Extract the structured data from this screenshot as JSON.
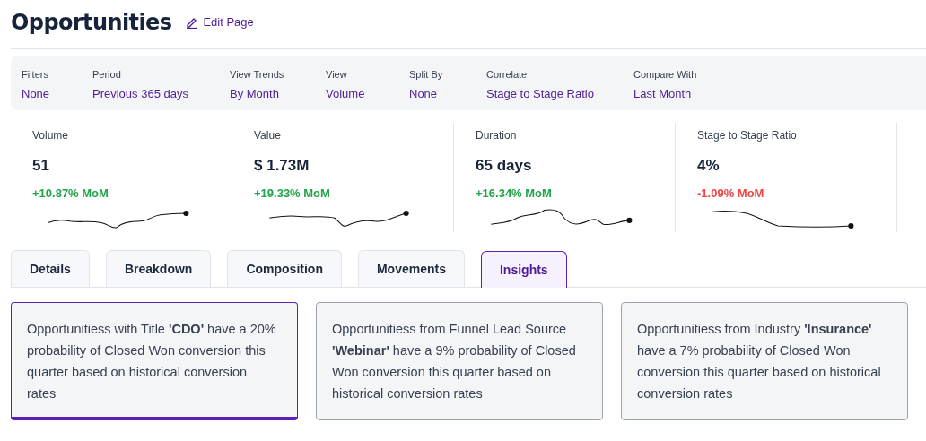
{
  "page": {
    "title": "Opportunities",
    "edit_link": "Edit Page"
  },
  "filters": [
    {
      "label": "Filters",
      "value": "None"
    },
    {
      "label": "Period",
      "value": "Previous 365 days"
    },
    {
      "label": "View Trends",
      "value": "By Month"
    },
    {
      "label": "View",
      "value": "Volume"
    },
    {
      "label": "Split By",
      "value": "None"
    },
    {
      "label": "Correlate",
      "value": "Stage to Stage Ratio"
    },
    {
      "label": "Compare With",
      "value": "Last Month"
    }
  ],
  "metrics": [
    {
      "label": "Volume",
      "value": "51",
      "change": "+10.87% MoM",
      "color": "#22a34a"
    },
    {
      "label": "Value",
      "value": "$ 1.73M",
      "change": "+19.33% MoM",
      "color": "#22a34a"
    },
    {
      "label": "Duration",
      "value": "65 days",
      "change": "+16.34% MoM",
      "color": "#22a34a"
    },
    {
      "label": "Stage to Stage Ratio",
      "value": "4%",
      "change": "-1.09% MoM",
      "color": "#ef4444"
    }
  ],
  "tabs": [
    {
      "label": "Details",
      "selected": false
    },
    {
      "label": "Breakdown",
      "selected": false
    },
    {
      "label": "Composition",
      "selected": false
    },
    {
      "label": "Movements",
      "selected": false
    },
    {
      "label": "Insights",
      "selected": true
    }
  ],
  "insights": [
    {
      "text": "Opportunitiess with Title **'CDO'** have a 20% probability of Closed Won conversion this quarter based on historical conversion rates",
      "selected": true
    },
    {
      "text": "Opportunitiess from Funnel Lead Source **'Webinar'** have a 9% probability of Closed Won conversion this quarter based on historical conversion rates",
      "selected": false
    },
    {
      "text": "Opportunitiess from Industry **'Insurance'** have a 7% probability of Closed Won conversion this quarter based on historical conversion rates",
      "selected": false
    }
  ]
}
